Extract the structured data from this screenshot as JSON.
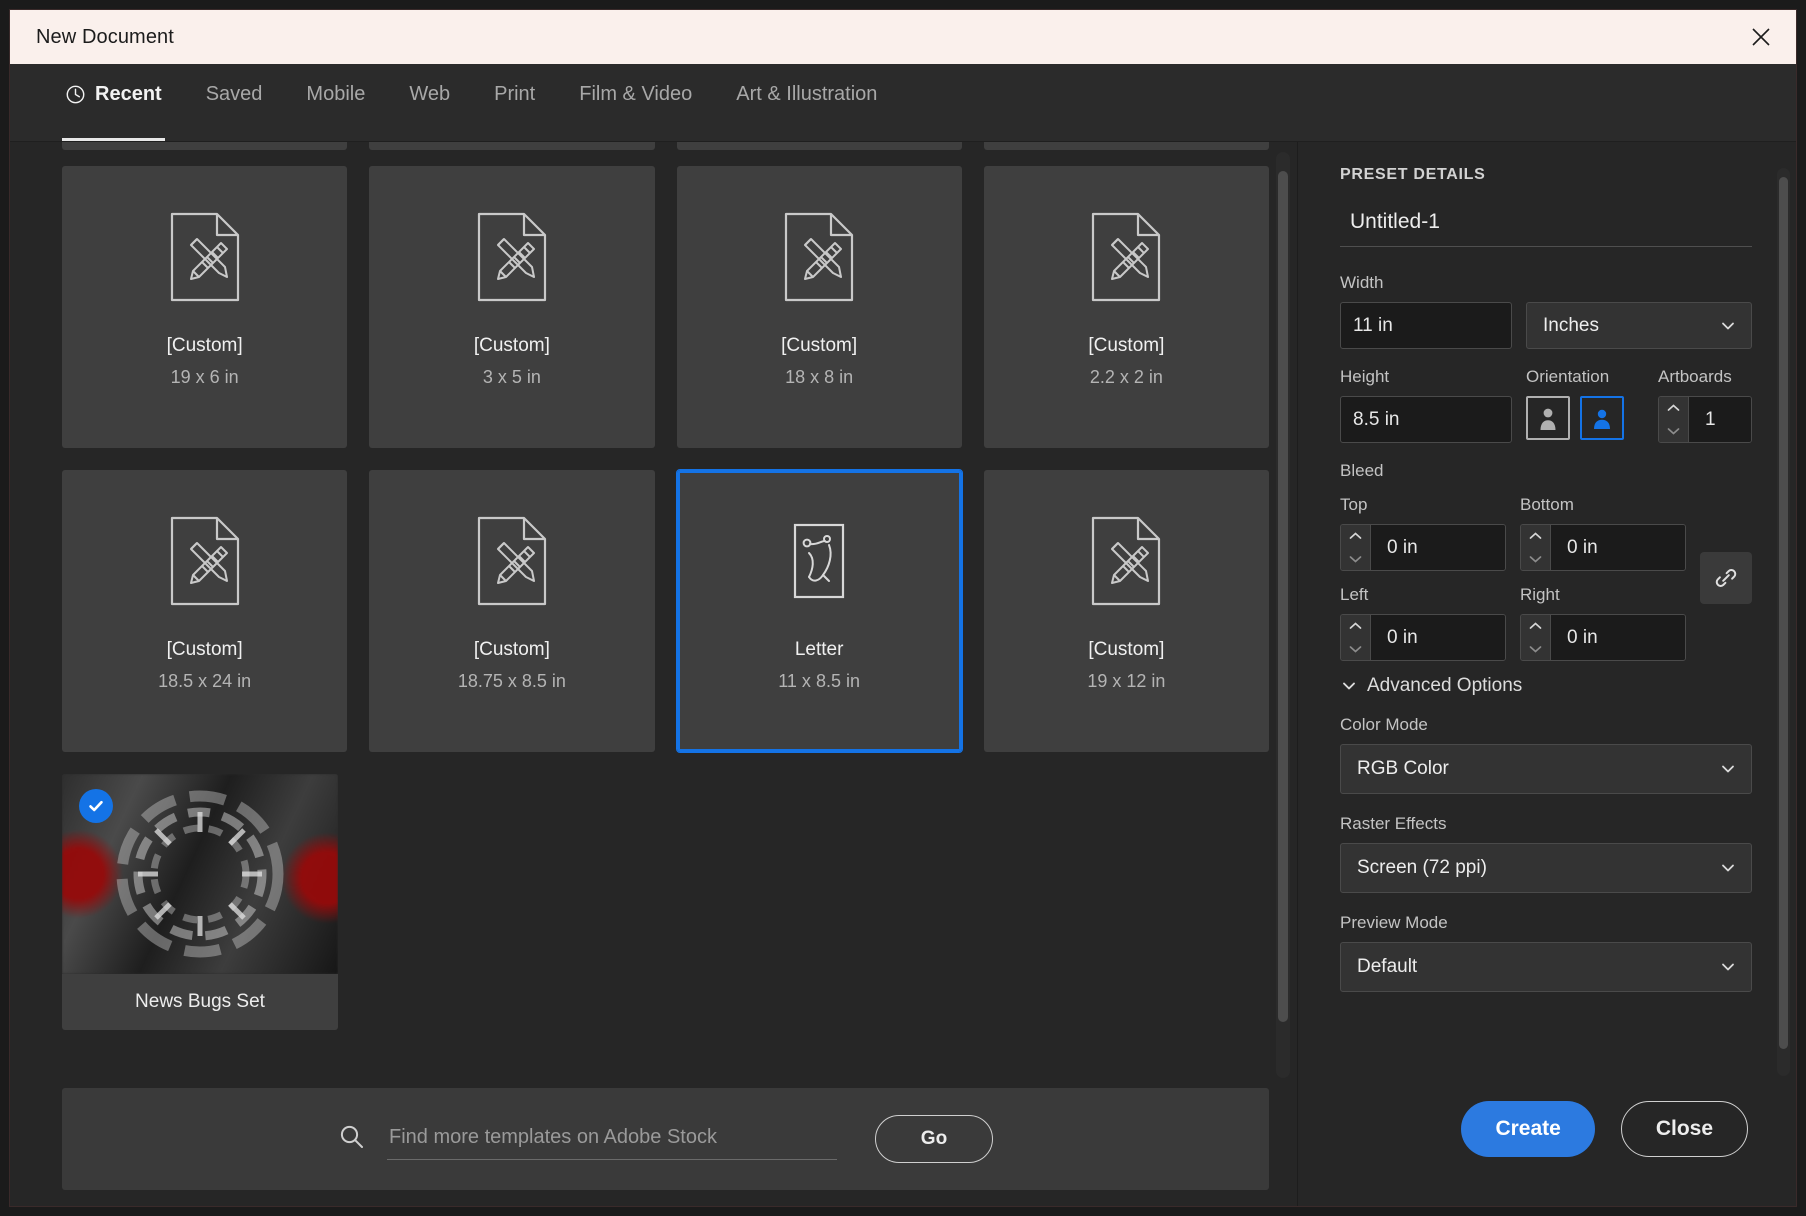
{
  "window": {
    "title": "New Document",
    "close_icon": "close-icon"
  },
  "tabs": [
    {
      "label": "Recent",
      "icon": "clock-icon",
      "active": true
    },
    {
      "label": "Saved",
      "active": false
    },
    {
      "label": "Mobile",
      "active": false
    },
    {
      "label": "Web",
      "active": false
    },
    {
      "label": "Print",
      "active": false
    },
    {
      "label": "Film & Video",
      "active": false
    },
    {
      "label": "Art & Illustration",
      "active": false
    }
  ],
  "presets": [
    {
      "name": "[Custom]",
      "size": "19 x 6 in",
      "selected": false
    },
    {
      "name": "[Custom]",
      "size": "3 x 5 in",
      "selected": false
    },
    {
      "name": "[Custom]",
      "size": "18 x 8 in",
      "selected": false
    },
    {
      "name": "[Custom]",
      "size": "2.2 x 2 in",
      "selected": false
    },
    {
      "name": "[Custom]",
      "size": "18.5 x 24 in",
      "selected": false
    },
    {
      "name": "[Custom]",
      "size": "18.75 x 8.5 in",
      "selected": false
    },
    {
      "name": "Letter",
      "size": "11 x 8.5 in",
      "selected": true
    },
    {
      "name": "[Custom]",
      "size": "19 x 12 in",
      "selected": false
    }
  ],
  "template_card": {
    "caption": "News Bugs Set",
    "badge_icon": "check-badge-icon"
  },
  "search": {
    "placeholder": "Find more templates on Adobe Stock",
    "value": "",
    "icon": "search-icon",
    "go_label": "Go"
  },
  "preset_details": {
    "heading": "PRESET DETAILS",
    "document_name": "Untitled-1",
    "width": {
      "label": "Width",
      "value": "11 in"
    },
    "units": {
      "value": "Inches"
    },
    "height": {
      "label": "Height",
      "value": "8.5 in"
    },
    "orientation": {
      "label": "Orientation",
      "portrait_icon": "portrait-orientation-icon",
      "landscape_icon": "landscape-orientation-icon",
      "selected": "landscape"
    },
    "artboards": {
      "label": "Artboards",
      "value": "1"
    },
    "bleed": {
      "heading": "Bleed",
      "top": {
        "label": "Top",
        "value": "0 in"
      },
      "bottom": {
        "label": "Bottom",
        "value": "0 in"
      },
      "left": {
        "label": "Left",
        "value": "0 in"
      },
      "right": {
        "label": "Right",
        "value": "0 in"
      },
      "link_icon": "link-chain-icon"
    },
    "advanced": {
      "label": "Advanced Options",
      "chevron_icon": "chevron-down-icon",
      "color_mode": {
        "label": "Color Mode",
        "value": "RGB Color"
      },
      "raster_effects": {
        "label": "Raster Effects",
        "value": "Screen (72 ppi)"
      },
      "preview_mode": {
        "label": "Preview Mode",
        "value": "Default"
      }
    }
  },
  "footer": {
    "create_label": "Create",
    "close_label": "Close"
  },
  "colors": {
    "accent": "#1473e6",
    "create_button": "#2c7ae0",
    "titlebar": "#faf0ec",
    "panel_bg": "#262626",
    "card_bg": "#3f3f3f"
  }
}
